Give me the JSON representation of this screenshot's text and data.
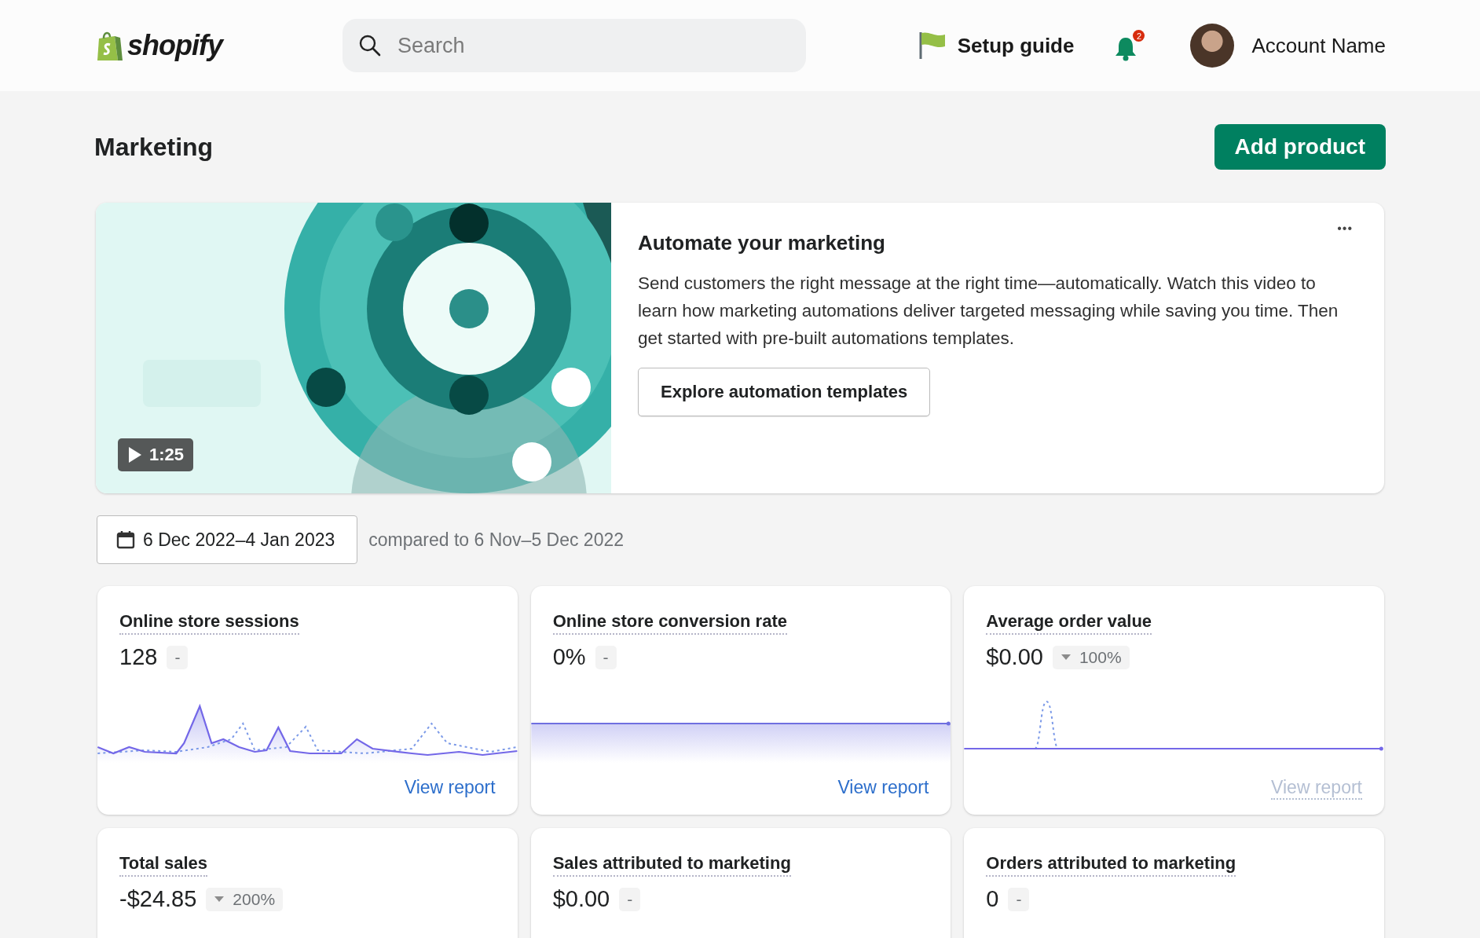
{
  "header": {
    "logo_text": "shopify",
    "search": {
      "placeholder": "Search"
    },
    "setup_guide": "Setup guide",
    "notification_count": "2",
    "account_name": "Account Name"
  },
  "page": {
    "title": "Marketing",
    "primary_action": "Add product"
  },
  "promo": {
    "video": {
      "kind": "picture",
      "duration": "1:25"
    },
    "title": "Automate your marketing",
    "body": "Send customers the right message at the right time—automatically. Watch this video to learn how marketing automations deliver targeted messaging while saving you time. Then get started with pre-built automations templates.",
    "button": "Explore automation templates",
    "menu": "•••"
  },
  "date_range": {
    "label": "6 Dec 2022–4 Jan 2023",
    "comparison": "compared to 6 Nov–5 Dec 2022"
  },
  "metrics": [
    {
      "title": "Online store sessions",
      "value": "128",
      "change": {
        "text": "-"
      },
      "chart": {
        "kind": "wavy"
      },
      "link": {
        "label": "View report",
        "disabled": false
      }
    },
    {
      "title": "Online store conversion rate",
      "value": "0%",
      "change": {
        "text": "-"
      },
      "chart": {
        "kind": "flat"
      },
      "link": {
        "label": "View report",
        "disabled": false
      }
    },
    {
      "title": "Average order value",
      "value": "$0.00",
      "change": {
        "text": "100%",
        "kind": "down"
      },
      "chart": {
        "kind": "spike"
      },
      "link": {
        "label": "View report",
        "disabled": true
      }
    },
    {
      "title": "Total sales",
      "value": "-$24.85",
      "change": {
        "text": "200%",
        "kind": "down"
      }
    },
    {
      "title": "Sales attributed to marketing",
      "value": "$0.00",
      "change": {
        "text": "-"
      }
    },
    {
      "title": "Orders attributed to marketing",
      "value": "0",
      "change": {
        "text": "-"
      }
    }
  ]
}
